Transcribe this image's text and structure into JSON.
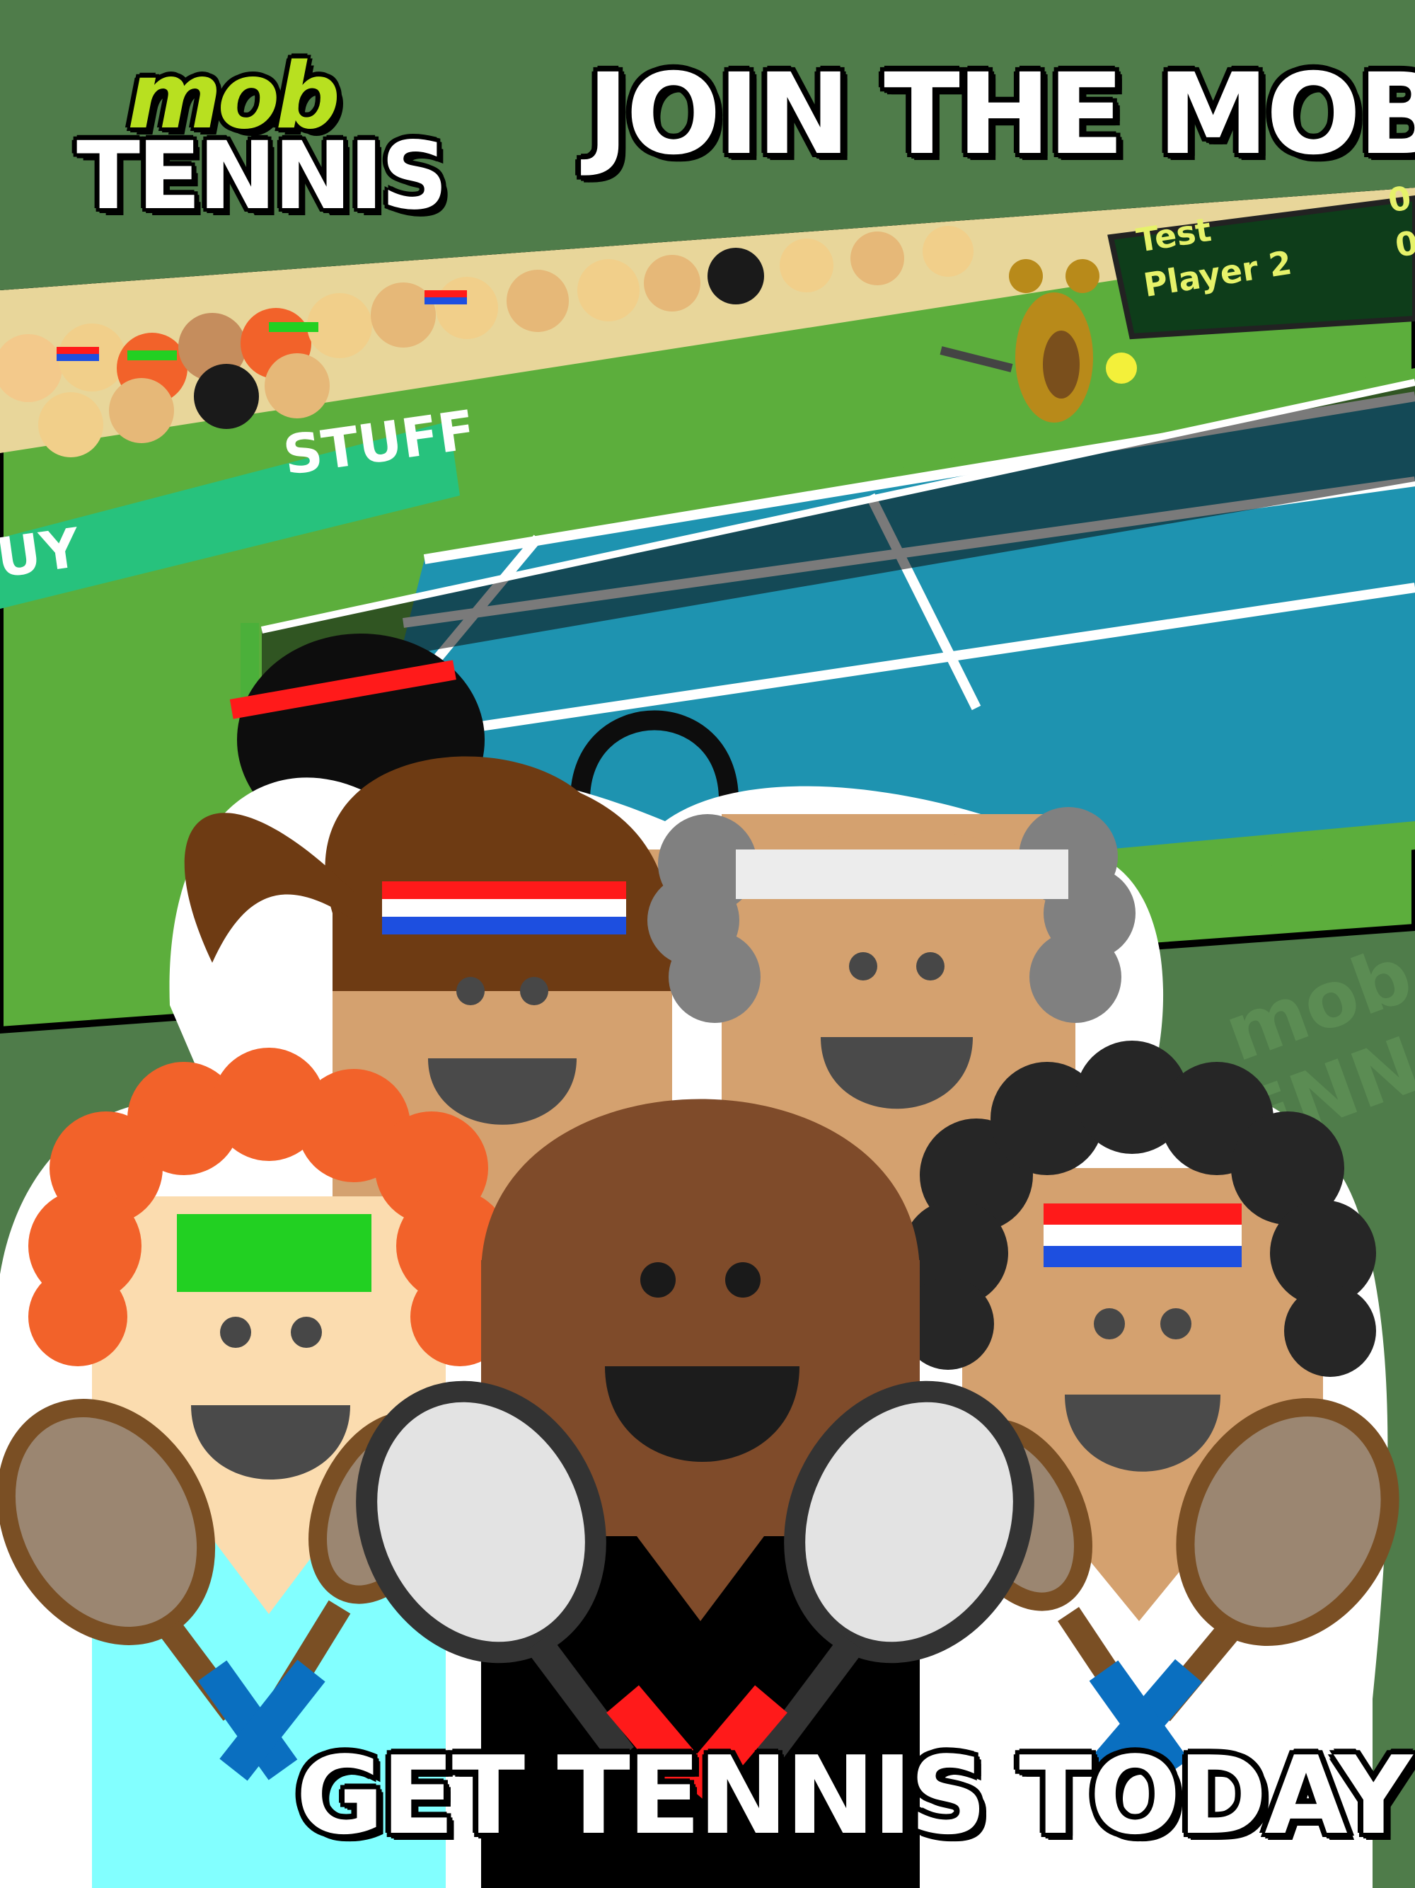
{
  "logo": {
    "word_top": "mob",
    "word_bottom": "TENNIS"
  },
  "headline": "JOIN THE MOB",
  "tagline": "GET TENNIS TODAY",
  "scoreboard": {
    "rows": [
      {
        "name": "Test",
        "score": "0"
      },
      {
        "name": "Player 2",
        "score": "0"
      }
    ]
  },
  "court_banner": {
    "left_text": "UY",
    "right_text": "STUFF"
  },
  "watermark": "mob TENNIS",
  "colors": {
    "background_green": "#4f7c4a",
    "court_blue": "#1e93b0",
    "grass_green": "#5cae3c",
    "logo_lime": "#b8e020",
    "headband_red": "#ff1a1a",
    "headband_blue": "#1d4fe0",
    "headband_green": "#22d022"
  }
}
